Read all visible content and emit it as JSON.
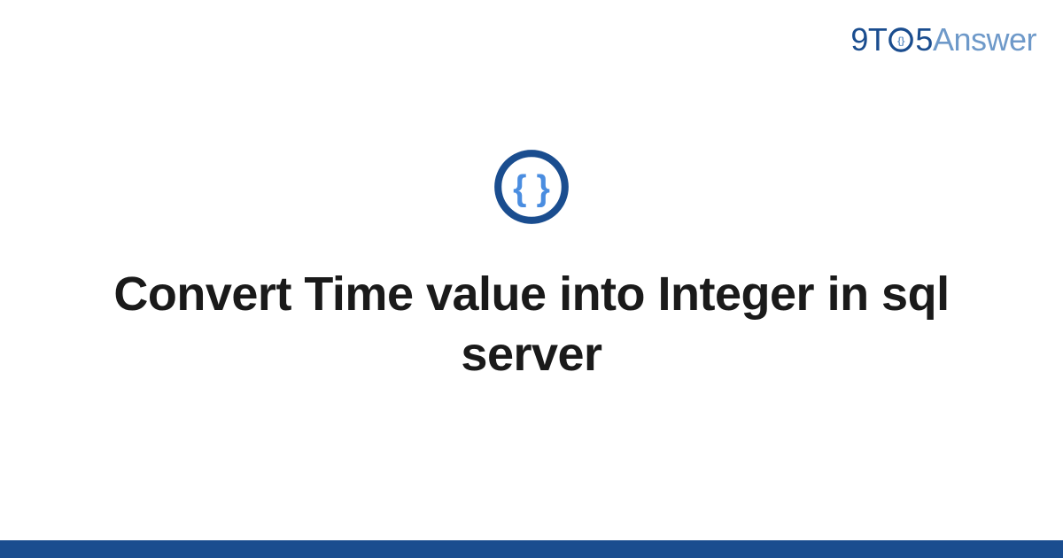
{
  "logo": {
    "part1": "9T",
    "part2": "5",
    "part3": "Answer"
  },
  "icon": {
    "name": "code-braces-icon",
    "glyph": "{ }"
  },
  "title": "Convert Time value into Integer in sql server",
  "colors": {
    "primary": "#1a4d8f",
    "secondary": "#6e99c9",
    "iconInner": "#4a8de0"
  }
}
